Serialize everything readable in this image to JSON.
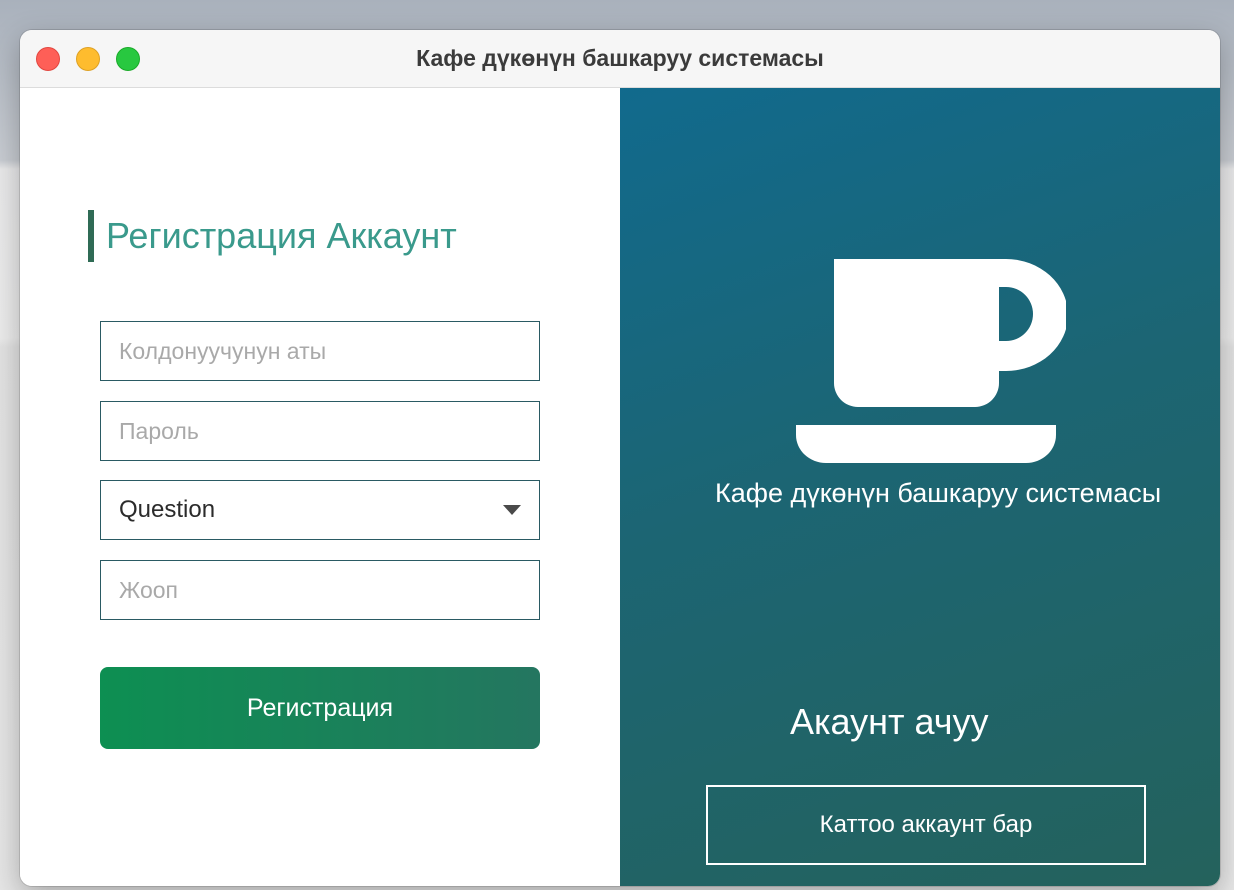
{
  "window": {
    "title": "Кафе дүкөнүн башкаруу системасы"
  },
  "register_form": {
    "heading": "Регистрация Аккаунт",
    "username_placeholder": "Колдонуучунун аты",
    "password_placeholder": "Пароль",
    "question_selected": "Question",
    "answer_placeholder": "Жооп",
    "register_button": "Регистрация"
  },
  "side_panel": {
    "icon": "coffee-cup-icon",
    "caption": "Кафе дүкөнүн башкаруу системасы",
    "open_account": "Акаунт ачуу",
    "have_account_button": "Каттоо аккаунт бар"
  },
  "colors": {
    "accent_green": "#0d8f52",
    "heading_teal": "#3a9a8c",
    "panel_blue": "#116a8d",
    "panel_green": "#24625c"
  }
}
